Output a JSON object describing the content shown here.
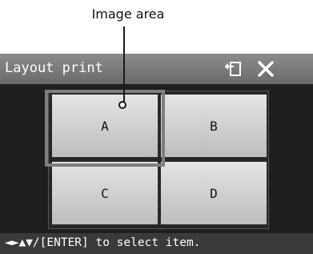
{
  "callout": {
    "label": "Image area"
  },
  "titlebar": {
    "title": "Layout print",
    "back_icon": "return-icon",
    "close_icon": "close-icon"
  },
  "layout": {
    "cells": [
      {
        "label": "A",
        "selected": true
      },
      {
        "label": "B",
        "selected": false
      },
      {
        "label": "C",
        "selected": false
      },
      {
        "label": "D",
        "selected": false
      }
    ]
  },
  "statusbar": {
    "hint": "◄►▲▼/[ENTER] to select item."
  },
  "colors": {
    "titlebar": "#7a7a7a",
    "background": "#1f1f1f",
    "cell": "#d0d0d0",
    "selection": "#7e7e7e"
  }
}
